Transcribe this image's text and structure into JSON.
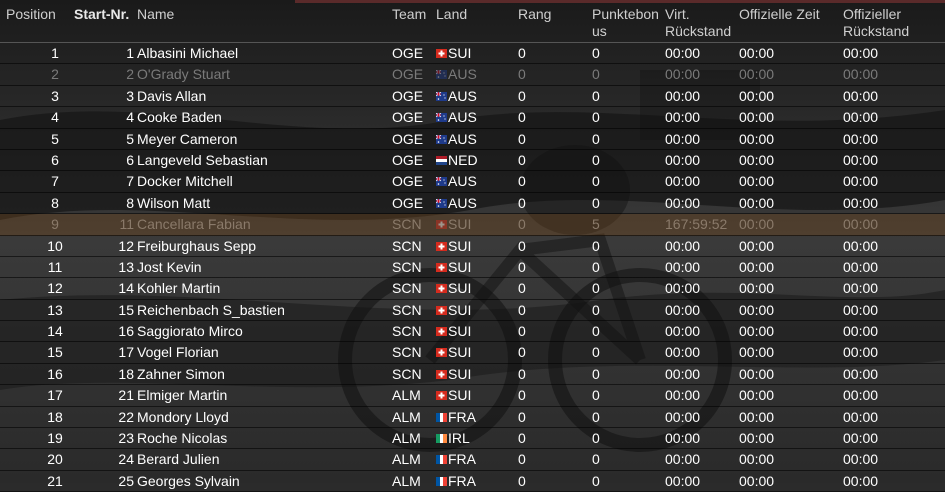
{
  "header": {
    "position": "Position",
    "start_nr": "Start-Nr.",
    "name": "Name",
    "team": "Team",
    "land": "Land",
    "rang": "Rang",
    "punktebonus_1": "Punktebon",
    "punktebonus_2": "us",
    "virt_1": "Virt.",
    "virt_2": "Rückstand",
    "offz": "Offizielle Zeit",
    "offr_1": "Offizieller",
    "offr_2": "Rückstand"
  },
  "rows": [
    {
      "pos": "1",
      "nr": "1",
      "name": "Albasini Michael",
      "team": "OGE",
      "flag": "ch",
      "land": "SUI",
      "rang": "0",
      "pkt": "0",
      "virt": "00:00",
      "offz": "00:00",
      "offr": "00:00",
      "state": "normal"
    },
    {
      "pos": "2",
      "nr": "2",
      "name": "O'Grady Stuart",
      "team": "OGE",
      "flag": "au",
      "land": "AUS",
      "rang": "0",
      "pkt": "0",
      "virt": "00:00",
      "offz": "00:00",
      "offr": "00:00",
      "state": "dim"
    },
    {
      "pos": "3",
      "nr": "3",
      "name": "Davis Allan",
      "team": "OGE",
      "flag": "au",
      "land": "AUS",
      "rang": "0",
      "pkt": "0",
      "virt": "00:00",
      "offz": "00:00",
      "offr": "00:00",
      "state": "normal"
    },
    {
      "pos": "4",
      "nr": "4",
      "name": "Cooke Baden",
      "team": "OGE",
      "flag": "au",
      "land": "AUS",
      "rang": "0",
      "pkt": "0",
      "virt": "00:00",
      "offz": "00:00",
      "offr": "00:00",
      "state": "normal"
    },
    {
      "pos": "5",
      "nr": "5",
      "name": "Meyer Cameron",
      "team": "OGE",
      "flag": "au",
      "land": "AUS",
      "rang": "0",
      "pkt": "0",
      "virt": "00:00",
      "offz": "00:00",
      "offr": "00:00",
      "state": "normal"
    },
    {
      "pos": "6",
      "nr": "6",
      "name": "Langeveld Sebastian",
      "team": "OGE",
      "flag": "nl",
      "land": "NED",
      "rang": "0",
      "pkt": "0",
      "virt": "00:00",
      "offz": "00:00",
      "offr": "00:00",
      "state": "normal"
    },
    {
      "pos": "7",
      "nr": "7",
      "name": "Docker Mitchell",
      "team": "OGE",
      "flag": "au",
      "land": "AUS",
      "rang": "0",
      "pkt": "0",
      "virt": "00:00",
      "offz": "00:00",
      "offr": "00:00",
      "state": "normal"
    },
    {
      "pos": "8",
      "nr": "8",
      "name": "Wilson Matt",
      "team": "OGE",
      "flag": "au",
      "land": "AUS",
      "rang": "0",
      "pkt": "0",
      "virt": "00:00",
      "offz": "00:00",
      "offr": "00:00",
      "state": "normal"
    },
    {
      "pos": "9",
      "nr": "11",
      "name": "Cancellara Fabian",
      "team": "SCN",
      "flag": "ch",
      "land": "SUI",
      "rang": "0",
      "pkt": "5",
      "virt": "167:59:52",
      "offz": "00:00",
      "offr": "00:00",
      "state": "hl"
    },
    {
      "pos": "10",
      "nr": "12",
      "name": "Freiburghaus Sepp",
      "team": "SCN",
      "flag": "ch",
      "land": "SUI",
      "rang": "0",
      "pkt": "0",
      "virt": "00:00",
      "offz": "00:00",
      "offr": "00:00",
      "state": "normal"
    },
    {
      "pos": "11",
      "nr": "13",
      "name": "Jost Kevin",
      "team": "SCN",
      "flag": "ch",
      "land": "SUI",
      "rang": "0",
      "pkt": "0",
      "virt": "00:00",
      "offz": "00:00",
      "offr": "00:00",
      "state": "normal"
    },
    {
      "pos": "12",
      "nr": "14",
      "name": "Kohler Martin",
      "team": "SCN",
      "flag": "ch",
      "land": "SUI",
      "rang": "0",
      "pkt": "0",
      "virt": "00:00",
      "offz": "00:00",
      "offr": "00:00",
      "state": "normal"
    },
    {
      "pos": "13",
      "nr": "15",
      "name": "Reichenbach S_bastien",
      "team": "SCN",
      "flag": "ch",
      "land": "SUI",
      "rang": "0",
      "pkt": "0",
      "virt": "00:00",
      "offz": "00:00",
      "offr": "00:00",
      "state": "normal"
    },
    {
      "pos": "14",
      "nr": "16",
      "name": "Saggiorato Mirco",
      "team": "SCN",
      "flag": "ch",
      "land": "SUI",
      "rang": "0",
      "pkt": "0",
      "virt": "00:00",
      "offz": "00:00",
      "offr": "00:00",
      "state": "normal"
    },
    {
      "pos": "15",
      "nr": "17",
      "name": "Vogel Florian",
      "team": "SCN",
      "flag": "ch",
      "land": "SUI",
      "rang": "0",
      "pkt": "0",
      "virt": "00:00",
      "offz": "00:00",
      "offr": "00:00",
      "state": "normal"
    },
    {
      "pos": "16",
      "nr": "18",
      "name": "Zahner Simon",
      "team": "SCN",
      "flag": "ch",
      "land": "SUI",
      "rang": "0",
      "pkt": "0",
      "virt": "00:00",
      "offz": "00:00",
      "offr": "00:00",
      "state": "normal"
    },
    {
      "pos": "17",
      "nr": "21",
      "name": "Elmiger Martin",
      "team": "ALM",
      "flag": "ch",
      "land": "SUI",
      "rang": "0",
      "pkt": "0",
      "virt": "00:00",
      "offz": "00:00",
      "offr": "00:00",
      "state": "normal"
    },
    {
      "pos": "18",
      "nr": "22",
      "name": "Mondory Lloyd",
      "team": "ALM",
      "flag": "fr",
      "land": "FRA",
      "rang": "0",
      "pkt": "0",
      "virt": "00:00",
      "offz": "00:00",
      "offr": "00:00",
      "state": "normal"
    },
    {
      "pos": "19",
      "nr": "23",
      "name": "Roche Nicolas",
      "team": "ALM",
      "flag": "ie",
      "land": "IRL",
      "rang": "0",
      "pkt": "0",
      "virt": "00:00",
      "offz": "00:00",
      "offr": "00:00",
      "state": "normal"
    },
    {
      "pos": "20",
      "nr": "24",
      "name": "Berard Julien",
      "team": "ALM",
      "flag": "fr",
      "land": "FRA",
      "rang": "0",
      "pkt": "0",
      "virt": "00:00",
      "offz": "00:00",
      "offr": "00:00",
      "state": "normal"
    },
    {
      "pos": "21",
      "nr": "25",
      "name": "Georges Sylvain",
      "team": "ALM",
      "flag": "fr",
      "land": "FRA",
      "rang": "0",
      "pkt": "0",
      "virt": "00:00",
      "offz": "00:00",
      "offr": "00:00",
      "state": "normal"
    }
  ]
}
